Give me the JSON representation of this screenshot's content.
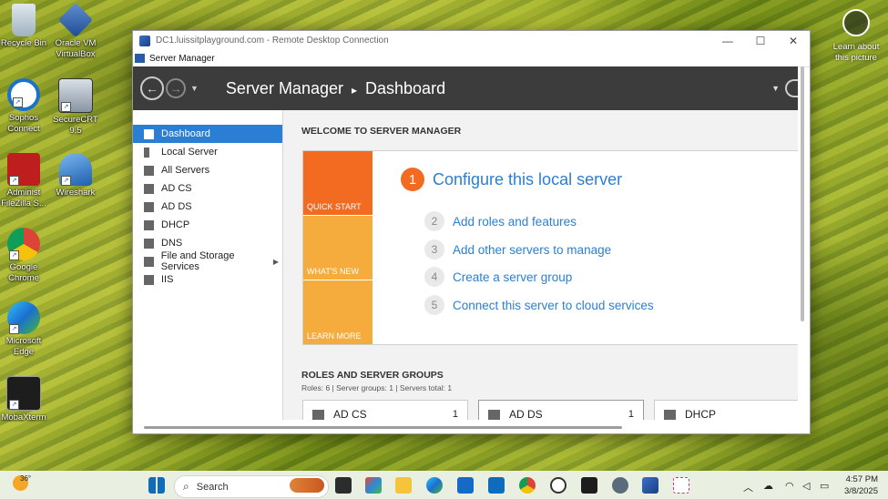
{
  "desktop": {
    "icons_left": [
      {
        "label": "Recycle Bin",
        "icon": "recycle-bin-icon"
      },
      {
        "label": "Sophos Connect",
        "icon": "sophos-icon"
      },
      {
        "label": "Administ FileZilla S...",
        "icon": "filezilla-icon"
      },
      {
        "label": "Google Chrome",
        "icon": "chrome-icon"
      },
      {
        "label": "Microsoft Edge",
        "icon": "edge-icon"
      },
      {
        "label": "MobaXterm",
        "icon": "mobaxterm-icon"
      }
    ],
    "icons_right": [
      {
        "label": "Oracle VM VirtualBox",
        "icon": "virtualbox-icon"
      },
      {
        "label": "SecureCRT 9.5",
        "icon": "securecrt-icon"
      },
      {
        "label": "Wireshark",
        "icon": "wireshark-icon"
      }
    ],
    "learn_about": "Learn about this picture"
  },
  "rdp": {
    "title": "DC1.luissitplayground.com - Remote Desktop Connection",
    "ctrl_min": "—",
    "ctrl_max": "☐",
    "ctrl_close": "✕"
  },
  "server_manager": {
    "window_title": "Server Manager",
    "breadcrumb_app": "Server Manager",
    "breadcrumb_sep": "▸",
    "breadcrumb_page": "Dashboard",
    "sidebar": [
      {
        "label": "Dashboard",
        "active": true
      },
      {
        "label": "Local Server"
      },
      {
        "label": "All Servers"
      },
      {
        "label": "AD CS"
      },
      {
        "label": "AD DS"
      },
      {
        "label": "DHCP"
      },
      {
        "label": "DNS"
      },
      {
        "label": "File and Storage Services",
        "has_arrow": true
      },
      {
        "label": "IIS"
      }
    ],
    "welcome_heading": "WELCOME TO SERVER MANAGER",
    "tiles": [
      "QUICK START",
      "WHAT'S NEW",
      "LEARN MORE"
    ],
    "configure": {
      "num": "1",
      "text": "Configure this local server"
    },
    "steps": [
      {
        "num": "2",
        "text": "Add roles and features"
      },
      {
        "num": "3",
        "text": "Add other servers to manage"
      },
      {
        "num": "4",
        "text": "Create a server group"
      },
      {
        "num": "5",
        "text": "Connect this server to cloud services"
      }
    ],
    "roles_heading": "ROLES AND SERVER GROUPS",
    "roles_summary": "Roles: 6   |   Server groups: 1   |   Servers total: 1",
    "role_cards": [
      {
        "name": "AD CS",
        "count": "1"
      },
      {
        "name": "AD DS",
        "count": "1"
      },
      {
        "name": "DHCP",
        "count": ""
      }
    ]
  },
  "taskbar": {
    "weather_temp": "36°",
    "search_placeholder": "Search",
    "time": "4:57 PM",
    "date": "3/8/2025"
  },
  "colors": {
    "accent": "#2a7fd4",
    "quick_start": "#f26b21",
    "tile_secondary": "#f6ac3d",
    "header_bg": "#3c3c3c"
  }
}
